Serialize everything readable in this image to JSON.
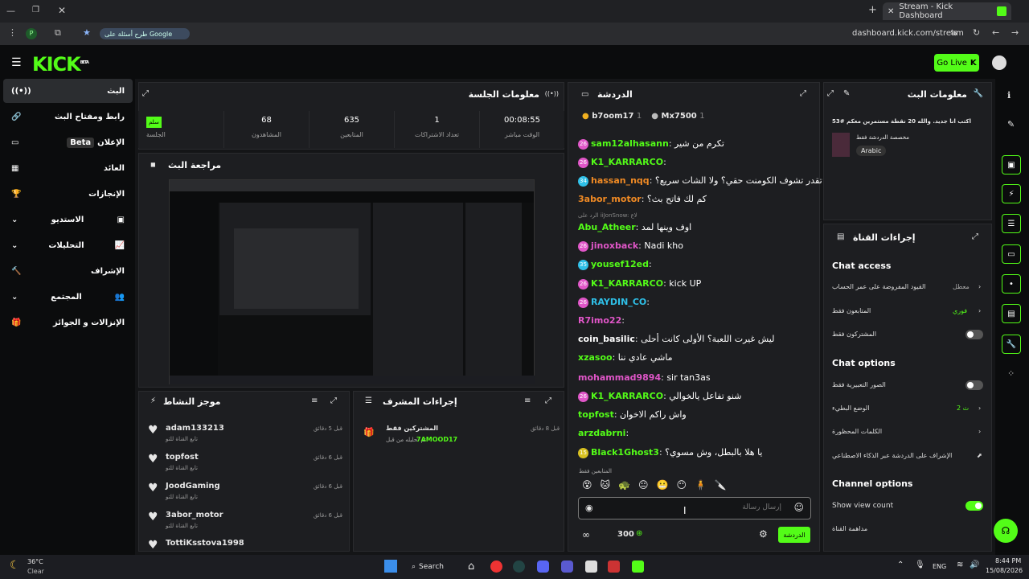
{
  "browser": {
    "tab_title": "Stream - Kick Dashboard",
    "url": "dashboard.kick.com/stream",
    "search_chip": "طرح أسئلة على Google",
    "profile": "P"
  },
  "header": {
    "logo": "KICK",
    "beta": "BETA",
    "go_live": "Go Live"
  },
  "sidebar": {
    "items": [
      {
        "label": "البث",
        "icon": "broadcast-icon"
      },
      {
        "label": "رابط ومفتاح البث",
        "icon": "link-icon"
      },
      {
        "label": "الإعلان",
        "badge": "Beta",
        "icon": "ad-icon"
      },
      {
        "label": "العائد",
        "icon": "revenue-icon"
      },
      {
        "label": "الإنجازات",
        "icon": "trophy-icon"
      },
      {
        "label": "الاستديو",
        "icon": "studio-icon"
      },
      {
        "label": "التحليلات",
        "icon": "analytics-icon"
      },
      {
        "label": "الإشراف",
        "icon": "moderation-icon"
      },
      {
        "label": "المجتمع",
        "icon": "community-icon"
      },
      {
        "label": "الإنزالات و الجوائز",
        "icon": "drops-icon"
      }
    ]
  },
  "session": {
    "title": "معلومات الجلسة",
    "badge": "سلم",
    "session_label": "الجلسة",
    "stats": [
      {
        "value": "68",
        "label": "المشاهدون"
      },
      {
        "value": "635",
        "label": "المتابعين"
      },
      {
        "value": "1",
        "label": "تعداد الاشتراكات"
      },
      {
        "value": "00:08:55",
        "label": "الوقت مباشر"
      }
    ]
  },
  "preview": {
    "title": "مراجعة البث"
  },
  "activity": {
    "title": "موجز النشاط",
    "items": [
      {
        "user": "adam133213",
        "desc": "تابع القناة للتو",
        "time": "قبل 5 دقائق"
      },
      {
        "user": "topfost",
        "desc": "تابع القناة للتو",
        "time": "قبل 6 دقائق"
      },
      {
        "user": "JoodGaming",
        "desc": "تابع القناة للتو",
        "time": "قبل 6 دقائق"
      },
      {
        "user": "3abor_motor",
        "desc": "تابع القناة للتو",
        "time": "قبل 6 دقائق"
      },
      {
        "user": "TottiKsstova1998",
        "desc": "",
        "time": ""
      }
    ]
  },
  "modactions": {
    "title": "إجراءات المشرف",
    "item": {
      "title": "المشتركين فقط",
      "desc": "تم تحليله من قبل",
      "user": "7AMOOD17",
      "time": "قبل 8 دقائق"
    }
  },
  "chat": {
    "title": "الدردشة",
    "top": [
      {
        "name": "b7oom17",
        "count": "1"
      },
      {
        "name": "Mx7500",
        "count": "1"
      }
    ],
    "lines": [
      {
        "user": "sam12alhasann",
        "color": "#53fc18",
        "msg": "تكرم من شير",
        "badge": "26",
        "bcolor": "#e056c8"
      },
      {
        "user": "K1_KARRARCO",
        "color": "#53fc18",
        "msg": "",
        "badge": "26",
        "bcolor": "#e056c8"
      },
      {
        "user": "hassan_nqq",
        "color": "#f08a24",
        "msg": "تقدر تشوف الكومنت حقي؟ ولا الشات سريع؟",
        "badge": "34",
        "bcolor": "#2fc0e8"
      },
      {
        "user": "3abor_motor",
        "color": "#f08a24",
        "msg": "كم لك فاتح بث؟",
        "badge": "",
        "bcolor": ""
      },
      {
        "user": "Abu_Atheer",
        "color": "#53fc18",
        "msg": "اوف وينها لمد",
        "badge": "",
        "bcolor": ""
      },
      {
        "user": "jinoxback",
        "color": "#e056c8",
        "msg": "Nadi kho",
        "badge": "26",
        "bcolor": "#e056c8"
      },
      {
        "user": "yousef12ed",
        "color": "#53fc18",
        "msg": "",
        "badge": "35",
        "bcolor": "#2fc0e8"
      },
      {
        "user": "K1_KARRARCO",
        "color": "#53fc18",
        "msg": "kick UP",
        "badge": "26",
        "bcolor": "#e056c8"
      },
      {
        "user": "RAYDIN_CO",
        "color": "#2fc0e8",
        "msg": "",
        "badge": "26",
        "bcolor": "#e056c8"
      },
      {
        "user": "R7imo22",
        "color": "#e056c8",
        "msg": "",
        "badge": "",
        "bcolor": ""
      },
      {
        "user": "coin_basilic",
        "color": "#ffffff",
        "msg": "ليش غيرت اللعبة؟ الأولى كانت أحلى",
        "badge": "",
        "bcolor": ""
      },
      {
        "user": "xzasoo",
        "color": "#53fc18",
        "msg": "ماشي عادي ننا",
        "badge": "",
        "bcolor": ""
      },
      {
        "user": "mohammad9894",
        "color": "#e056c8",
        "msg": "sir tan3as",
        "badge": "",
        "bcolor": ""
      },
      {
        "user": "K1_KARRARCO",
        "color": "#53fc18",
        "msg": "شنو تفاعل يالخوالي",
        "badge": "26",
        "bcolor": "#e056c8"
      },
      {
        "user": "topfost",
        "color": "#53fc18",
        "msg": "واش راكم الاخوان",
        "badge": "",
        "bcolor": ""
      },
      {
        "user": "arzdabrni",
        "color": "#53fc18",
        "msg": "",
        "badge": "",
        "bcolor": ""
      },
      {
        "user": "Black1Ghost3",
        "color": "#53fc18",
        "msg": "يا هلا بالبطل، وش مسوي؟",
        "badge": "15",
        "bcolor": "#d8c020"
      }
    ],
    "reply_to": "الرد على iiJonSnow: لاع",
    "followers_only": "المتابعين فقط",
    "input_placeholder": "إرسال رسالة",
    "points": "300",
    "send": "الدردشة"
  },
  "stream_info": {
    "title": "معلومات البث",
    "stream_title": "اكتب انا جديد. والله 20 نقطة مستمرين معكم #53",
    "category": "مخصصة الدردشة فقط",
    "tag": "Arabic"
  },
  "channel_actions": {
    "title": "إجراءات القناة",
    "chat_access": "Chat access",
    "rows1": [
      {
        "label": "القيود المفروضة على عمر الحساب",
        "value": "معطل"
      },
      {
        "label": "المتابعون فقط",
        "value": "فوري"
      },
      {
        "label": "المشتركون فقط",
        "value": ""
      }
    ],
    "chat_options": "Chat options",
    "rows2": [
      {
        "label": "الصور التعبيرية فقط",
        "value": ""
      },
      {
        "label": "الوضع البطيء",
        "value": "2 ث"
      },
      {
        "label": "الكلمات المحظورة",
        "value": ""
      },
      {
        "label": "الإشراف على الدردشة عبر الذكاء الاصطناعي",
        "value": ""
      }
    ],
    "channel_options": "Channel options",
    "show_view_count": "Show view count",
    "channel_mode": "مداهمة القناة"
  },
  "taskbar": {
    "temp": "36°C",
    "weather": "Clear",
    "search": "Search",
    "lang": "ENG",
    "time": "8:44 PM",
    "date": "15/08/2026"
  }
}
